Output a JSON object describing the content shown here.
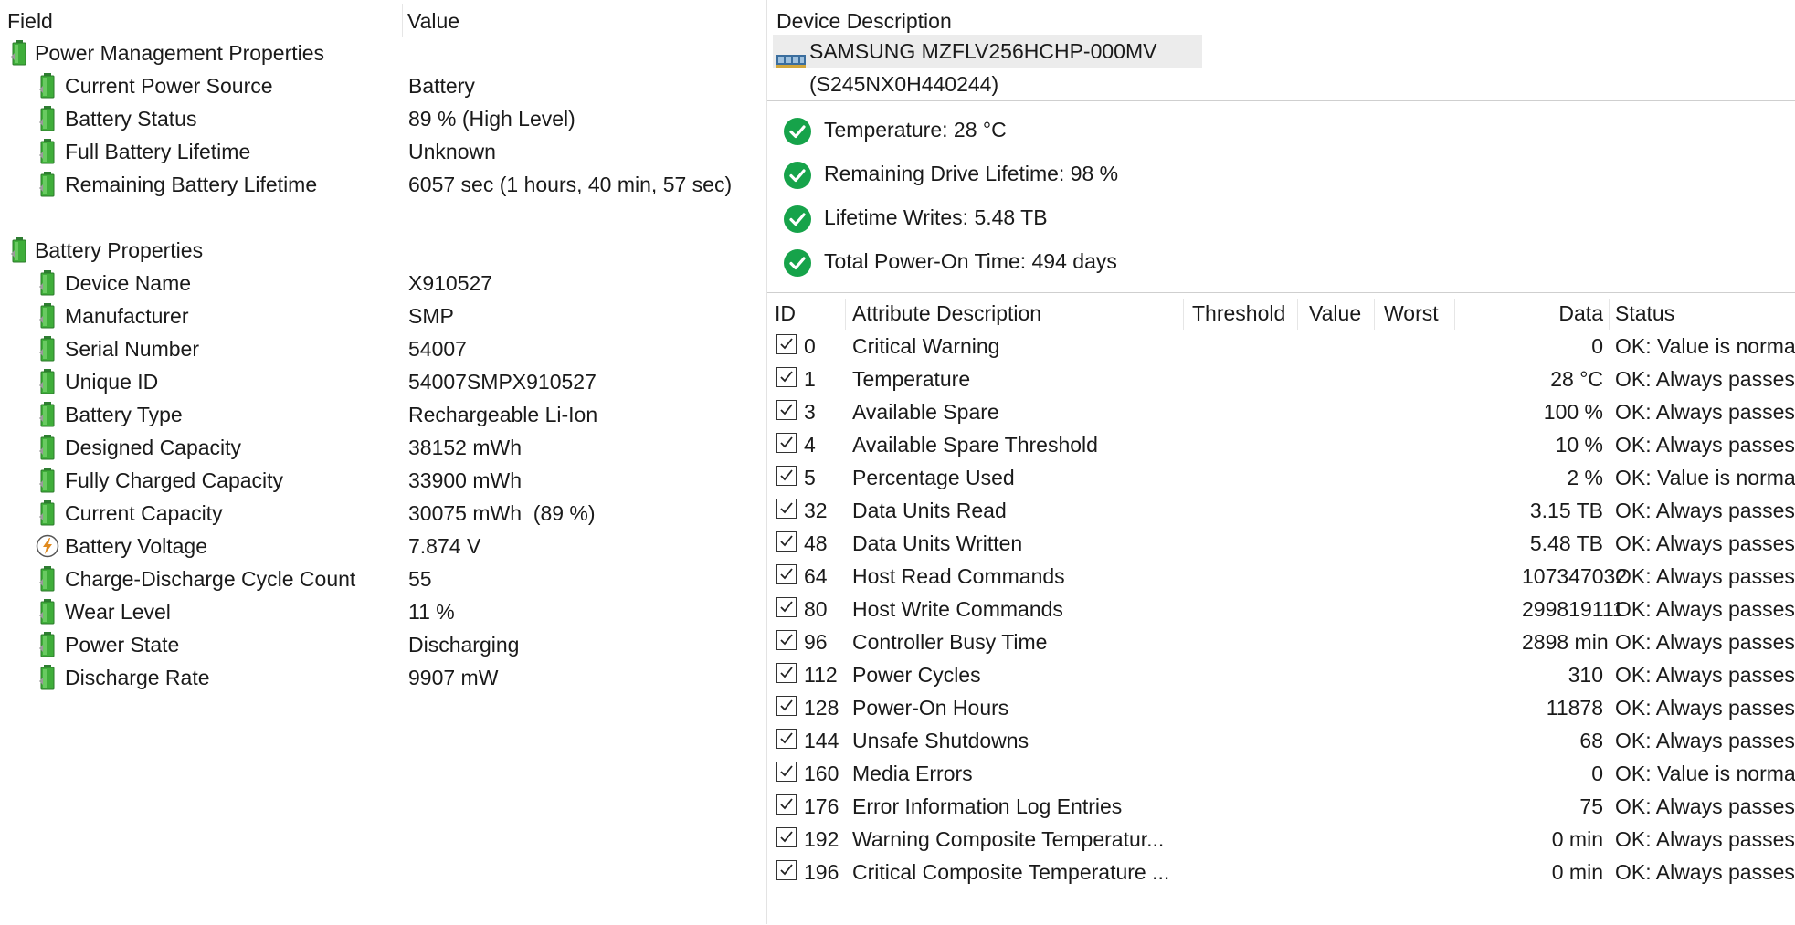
{
  "left": {
    "headers": {
      "field": "Field",
      "value": "Value"
    },
    "groups": [
      {
        "title": "Power Management Properties",
        "items": [
          {
            "label": "Current Power Source",
            "value": "Battery",
            "icon": "battery-icon"
          },
          {
            "label": "Battery Status",
            "value": "89 % (High Level)",
            "icon": "battery-icon"
          },
          {
            "label": "Full Battery Lifetime",
            "value": "Unknown",
            "icon": "battery-icon"
          },
          {
            "label": "Remaining Battery Lifetime",
            "value": "6057 sec (1 hours, 40 min, 57 sec)",
            "icon": "battery-icon"
          }
        ]
      },
      {
        "title": "Battery Properties",
        "items": [
          {
            "label": "Device Name",
            "value": "X910527",
            "icon": "battery-icon"
          },
          {
            "label": "Manufacturer",
            "value": "SMP",
            "icon": "battery-icon"
          },
          {
            "label": "Serial Number",
            "value": "54007",
            "icon": "battery-icon"
          },
          {
            "label": "Unique ID",
            "value": "54007SMPX910527",
            "icon": "battery-icon"
          },
          {
            "label": "Battery Type",
            "value": "Rechargeable Li-Ion",
            "icon": "battery-icon"
          },
          {
            "label": "Designed Capacity",
            "value": "38152 mWh",
            "icon": "battery-icon"
          },
          {
            "label": "Fully Charged Capacity",
            "value": "33900 mWh",
            "icon": "battery-icon"
          },
          {
            "label": "Current Capacity",
            "value": "30075 mWh  (89 %)",
            "icon": "battery-icon"
          },
          {
            "label": "Battery Voltage",
            "value": "7.874 V",
            "icon": "lightning-icon"
          },
          {
            "label": "Charge-Discharge Cycle Count",
            "value": "55",
            "icon": "battery-icon"
          },
          {
            "label": "Wear Level",
            "value": "11 %",
            "icon": "battery-icon"
          },
          {
            "label": "Power State",
            "value": "Discharging",
            "icon": "battery-icon"
          },
          {
            "label": "Discharge Rate",
            "value": "9907 mW",
            "icon": "battery-icon"
          }
        ]
      }
    ]
  },
  "right": {
    "device_header": "Device Description",
    "device_name": "SAMSUNG MZFLV256HCHP-000MV (S245NX0H440244)",
    "status_items": [
      "Temperature: 28 °C",
      "Remaining Drive Lifetime: 98 %",
      "Lifetime Writes: 5.48 TB",
      "Total Power-On Time: 494 days"
    ],
    "table_headers": {
      "id": "ID",
      "attr": "Attribute Description",
      "threshold": "Threshold",
      "value": "Value",
      "worst": "Worst",
      "data": "Data",
      "status": "Status"
    },
    "rows": [
      {
        "id": "0",
        "attr": "Critical Warning",
        "data": "0",
        "status": "OK: Value is normal"
      },
      {
        "id": "1",
        "attr": "Temperature",
        "data": "28 °C",
        "status": "OK: Always passes"
      },
      {
        "id": "3",
        "attr": "Available Spare",
        "data": "100 %",
        "status": "OK: Always passes"
      },
      {
        "id": "4",
        "attr": "Available Spare Threshold",
        "data": "10 %",
        "status": "OK: Always passes"
      },
      {
        "id": "5",
        "attr": "Percentage Used",
        "data": "2 %",
        "status": "OK: Value is normal"
      },
      {
        "id": "32",
        "attr": "Data Units Read",
        "data": "3.15 TB",
        "status": "OK: Always passes"
      },
      {
        "id": "48",
        "attr": "Data Units Written",
        "data": "5.48 TB",
        "status": "OK: Always passes"
      },
      {
        "id": "64",
        "attr": "Host Read Commands",
        "data": "107347032",
        "status": "OK: Always passes"
      },
      {
        "id": "80",
        "attr": "Host Write Commands",
        "data": "299819111",
        "status": "OK: Always passes"
      },
      {
        "id": "96",
        "attr": "Controller Busy Time",
        "data": "2898 min",
        "status": "OK: Always passes"
      },
      {
        "id": "112",
        "attr": "Power Cycles",
        "data": "310",
        "status": "OK: Always passes"
      },
      {
        "id": "128",
        "attr": "Power-On Hours",
        "data": "11878",
        "status": "OK: Always passes"
      },
      {
        "id": "144",
        "attr": "Unsafe Shutdowns",
        "data": "68",
        "status": "OK: Always passes"
      },
      {
        "id": "160",
        "attr": "Media Errors",
        "data": "0",
        "status": "OK: Value is normal"
      },
      {
        "id": "176",
        "attr": "Error Information Log Entries",
        "data": "75",
        "status": "OK: Always passes"
      },
      {
        "id": "192",
        "attr": "Warning Composite Temperatur...",
        "data": "0 min",
        "status": "OK: Always passes"
      },
      {
        "id": "196",
        "attr": "Critical Composite Temperature ...",
        "data": "0 min",
        "status": "OK: Always passes"
      }
    ]
  },
  "colors": {
    "battery_green": "#3fae3a",
    "ok_green": "#16a34a",
    "text": "#1a1a1a"
  }
}
